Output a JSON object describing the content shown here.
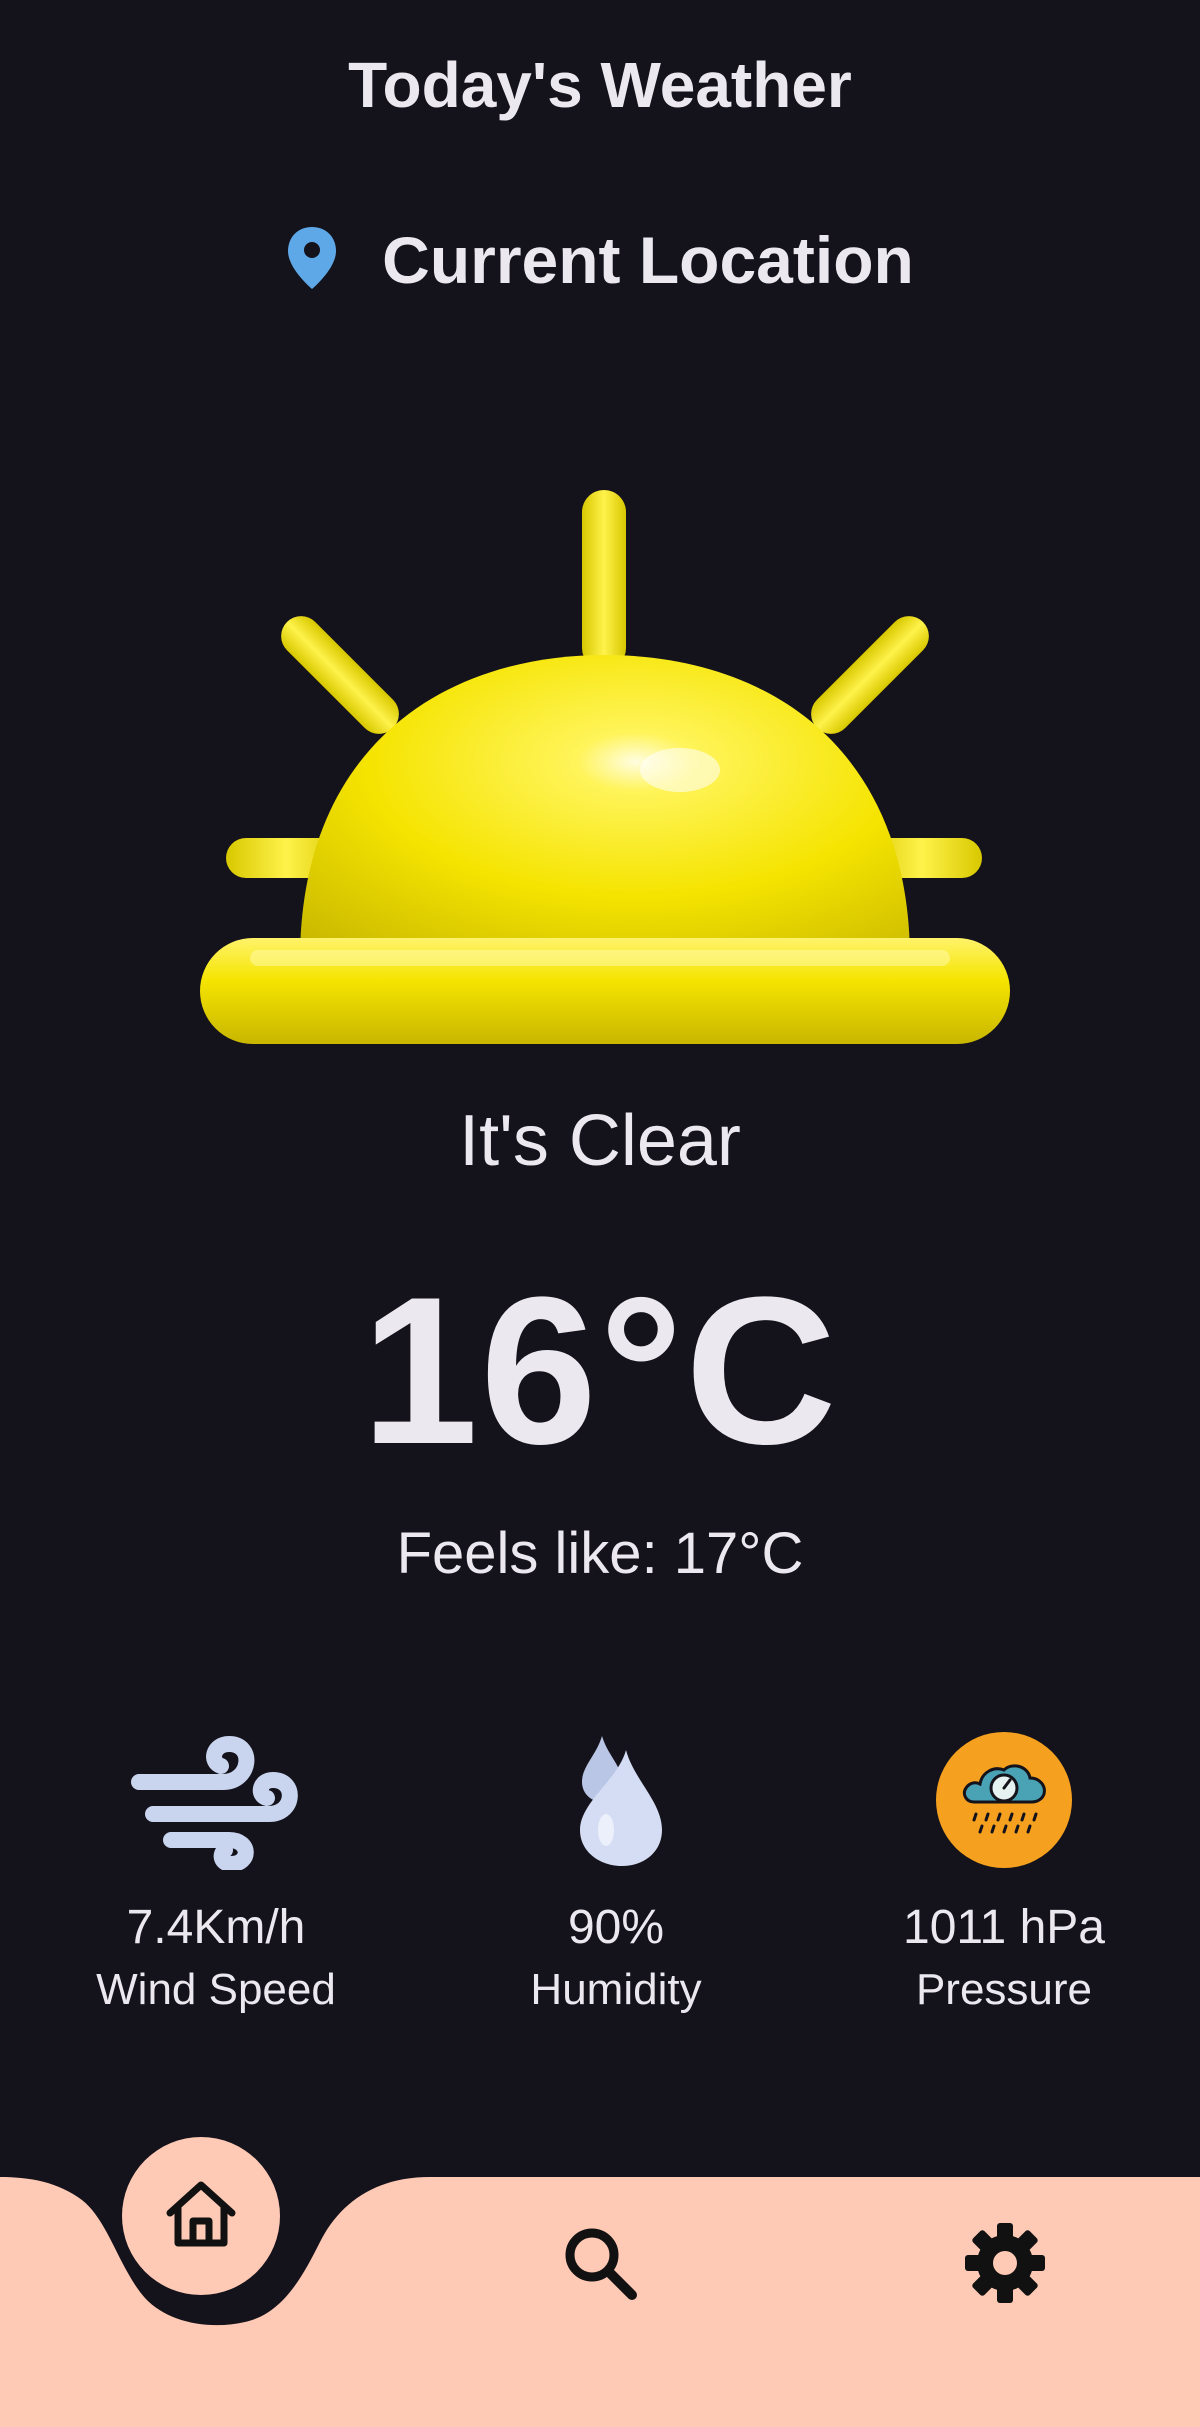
{
  "header": {
    "title": "Today's Weather",
    "location_label": "Current Location",
    "location_icon": "location-pin-icon"
  },
  "weather": {
    "condition": "It's Clear",
    "temperature": "16°C",
    "feels_like": "Feels like: 17°C",
    "illustration_icon": "sun-icon"
  },
  "metrics": [
    {
      "value": "7.4Km/h",
      "label": "Wind Speed",
      "icon": "wind-icon"
    },
    {
      "value": "90%",
      "label": "Humidity",
      "icon": "water-drops-icon"
    },
    {
      "value": "1011 hPa",
      "label": "Pressure",
      "icon": "pressure-gauge-icon"
    }
  ],
  "nav": [
    {
      "name": "home",
      "icon": "home-icon",
      "active": true
    },
    {
      "name": "search",
      "icon": "search-icon",
      "active": false
    },
    {
      "name": "settings",
      "icon": "gear-icon",
      "active": false
    }
  ],
  "colors": {
    "background": "#14121a",
    "text": "#ece8ef",
    "accent_pin": "#5fa8e8",
    "sun": "#f5e400",
    "nav_bar": "#fec9b5",
    "pressure_badge": "#f6a01f",
    "icon_light": "#c9d4ee"
  }
}
